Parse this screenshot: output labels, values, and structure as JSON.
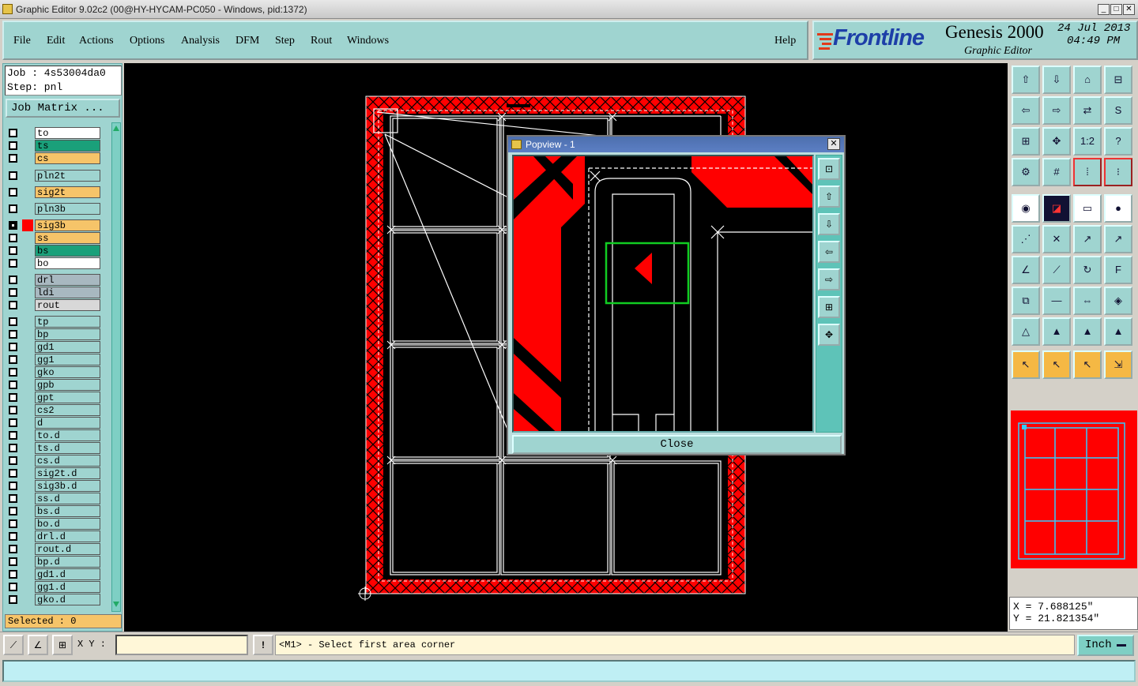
{
  "window": {
    "title": "Graphic Editor 9.02c2 (00@HY-HYCAM-PC050 - Windows, pid:1372)",
    "min": "_",
    "max": "□",
    "close": "✕"
  },
  "menu": {
    "items": [
      "File",
      "Edit",
      "Actions",
      "Options",
      "Analysis",
      "DFM",
      "Step",
      "Rout",
      "Windows"
    ],
    "help": "Help"
  },
  "brand": {
    "logo": "Frontline",
    "product": "Genesis 2000",
    "subtitle": "Graphic Editor",
    "date": "24 Jul 2013",
    "time": "04:49 PM"
  },
  "job": {
    "job_line": "Job : 4s53004da0",
    "step_line": "Step: pnl",
    "matrix_button": "Job Matrix ..."
  },
  "layers": [
    {
      "name": "to",
      "color": "#ffffff",
      "checked": false
    },
    {
      "name": "ts",
      "color": "#1aa07a",
      "checked": false
    },
    {
      "name": "cs",
      "color": "#f6c469",
      "checked": false
    },
    {
      "name": "pln2t",
      "color": "#9fd4d0",
      "checked": false
    },
    {
      "name": "sig2t",
      "color": "#f6c469",
      "checked": false
    },
    {
      "name": "pln3b",
      "color": "#9fd4d0",
      "checked": false
    },
    {
      "name": "sig3b",
      "color": "#f6c469",
      "checked": true,
      "swatch": "#ff0000"
    },
    {
      "name": "ss",
      "color": "#f6c469",
      "checked": false
    },
    {
      "name": "bs",
      "color": "#1aa07a",
      "checked": false
    },
    {
      "name": "bo",
      "color": "#ffffff",
      "checked": false
    },
    {
      "name": "drl",
      "color": "#a8b8c0",
      "checked": false
    },
    {
      "name": "ldi",
      "color": "#a8b8c0",
      "checked": false
    },
    {
      "name": "rout",
      "color": "#d8d8d8",
      "checked": false
    },
    {
      "name": "tp",
      "color": "#9fd4d0",
      "checked": false
    },
    {
      "name": "bp",
      "color": "#9fd4d0",
      "checked": false
    },
    {
      "name": "gd1",
      "color": "#9fd4d0",
      "checked": false
    },
    {
      "name": "gg1",
      "color": "#9fd4d0",
      "checked": false
    },
    {
      "name": "gko",
      "color": "#9fd4d0",
      "checked": false
    },
    {
      "name": "gpb",
      "color": "#9fd4d0",
      "checked": false
    },
    {
      "name": "gpt",
      "color": "#9fd4d0",
      "checked": false
    },
    {
      "name": "cs2",
      "color": "#9fd4d0",
      "checked": false
    },
    {
      "name": "d",
      "color": "#9fd4d0",
      "checked": false
    },
    {
      "name": "to.d",
      "color": "#9fd4d0",
      "checked": false
    },
    {
      "name": "ts.d",
      "color": "#9fd4d0",
      "checked": false
    },
    {
      "name": "cs.d",
      "color": "#9fd4d0",
      "checked": false
    },
    {
      "name": "sig2t.d",
      "color": "#9fd4d0",
      "checked": false
    },
    {
      "name": "sig3b.d",
      "color": "#9fd4d0",
      "checked": false
    },
    {
      "name": "ss.d",
      "color": "#9fd4d0",
      "checked": false
    },
    {
      "name": "bs.d",
      "color": "#9fd4d0",
      "checked": false
    },
    {
      "name": "bo.d",
      "color": "#9fd4d0",
      "checked": false
    },
    {
      "name": "drl.d",
      "color": "#9fd4d0",
      "checked": false
    },
    {
      "name": "rout.d",
      "color": "#9fd4d0",
      "checked": false
    },
    {
      "name": "bp.d",
      "color": "#9fd4d0",
      "checked": false
    },
    {
      "name": "gd1.d",
      "color": "#9fd4d0",
      "checked": false
    },
    {
      "name": "gg1.d",
      "color": "#9fd4d0",
      "checked": false
    },
    {
      "name": "gko.d",
      "color": "#9fd4d0",
      "checked": false
    }
  ],
  "selected": "Selected : 0",
  "popview": {
    "title": "Popview - 1",
    "close_label": "Close"
  },
  "coords": {
    "x": "X = 7.688125\"",
    "y": "Y = 21.821354\""
  },
  "tool_label": "1:2",
  "bottom": {
    "xy_label": "X Y :",
    "xy_value": "",
    "prompt": "<M1> - Select first area corner",
    "unit": "Inch"
  },
  "colors": {
    "accent": "#9fd4d0",
    "copper": "#ff0000",
    "highlight": "#f6c469"
  }
}
